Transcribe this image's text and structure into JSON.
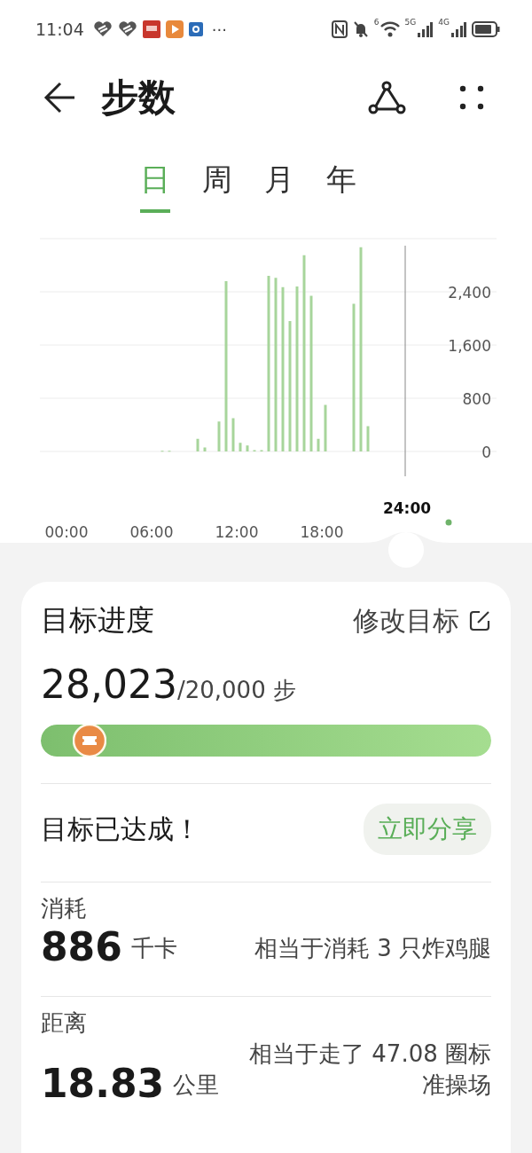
{
  "status_bar": {
    "time": "11:04",
    "more": "···",
    "network_5g": "5G",
    "network_4g": "4G",
    "wifi_label": "6"
  },
  "header": {
    "title": "步数"
  },
  "tabs": [
    {
      "label": "日",
      "selected": true
    },
    {
      "label": "周",
      "selected": false
    },
    {
      "label": "月",
      "selected": false
    },
    {
      "label": "年",
      "selected": false
    }
  ],
  "chart": {
    "chart_data": {
      "type": "bar",
      "grid": true,
      "x": [
        6.5,
        7,
        9,
        9.5,
        10.5,
        11,
        11.5,
        12,
        12.5,
        13,
        13.5,
        14,
        14.5,
        15,
        15.5,
        16,
        16.5,
        17,
        17.5,
        18,
        20,
        20.5,
        21
      ],
      "values": [
        10,
        10,
        190,
        60,
        450,
        2560,
        500,
        130,
        90,
        20,
        20,
        2640,
        2610,
        2470,
        1960,
        2480,
        2950,
        2340,
        190,
        700,
        2220,
        3070,
        380
      ],
      "xlim": [
        0,
        24
      ],
      "ylim": [
        0,
        3200
      ],
      "yticks": [
        {
          "value": 0,
          "label": "0"
        },
        {
          "value": 800,
          "label": "800"
        },
        {
          "value": 1600,
          "label": "1,600"
        },
        {
          "value": 2400,
          "label": "2,400"
        }
      ],
      "xticks": [
        {
          "value": 0,
          "label": "00:00"
        },
        {
          "value": 6,
          "label": "06:00"
        },
        {
          "value": 12,
          "label": "12:00"
        },
        {
          "value": 18,
          "label": "18:00"
        }
      ]
    },
    "cursor_label": "24:00"
  },
  "goal": {
    "title": "目标进度",
    "edit": "修改目标",
    "steps": "28,023",
    "target": "/20,000 步",
    "level": 1,
    "message": "目标已达成！",
    "share": "立即分享"
  },
  "stats": [
    {
      "label": "消耗",
      "value": "886",
      "unit": "千卡",
      "note": "相当于消耗 3 只炸鸡腿"
    },
    {
      "label": "距离",
      "value": "18.83",
      "unit": "公里",
      "note": "相当于走了 47.08 圈标准操场"
    }
  ]
}
